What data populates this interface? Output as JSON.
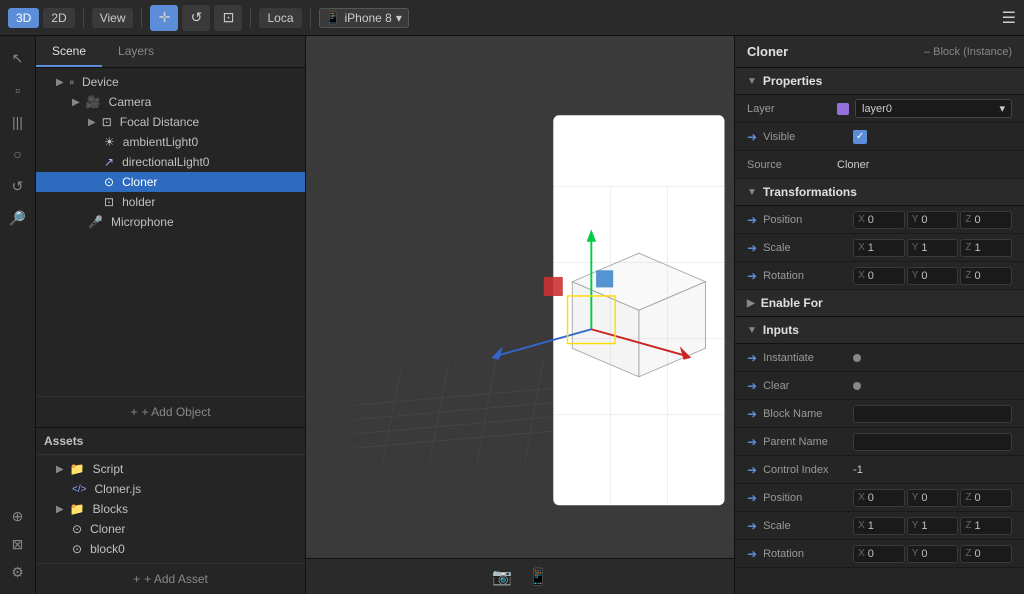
{
  "topbar": {
    "btn_3d": "3D",
    "btn_2d": "2D",
    "btn_view": "View",
    "btn_loc": "Loca",
    "device_name": "iPhone 8",
    "icons": [
      "✛",
      "↺",
      "⊡"
    ]
  },
  "scene_panel": {
    "tab_scene": "Scene",
    "tab_layers": "Layers",
    "tree": [
      {
        "label": "Device",
        "level": 1,
        "icon": "▫",
        "type": "folder",
        "arrow": "▶"
      },
      {
        "label": "Camera",
        "level": 2,
        "icon": "📷",
        "type": "folder",
        "arrow": "▶"
      },
      {
        "label": "Focal Distance",
        "level": 3,
        "icon": "⊡",
        "type": "folder",
        "arrow": "▶"
      },
      {
        "label": "ambientLight0",
        "level": 4,
        "icon": "☀",
        "type": "item"
      },
      {
        "label": "directionalLight0",
        "level": 4,
        "icon": "↗",
        "type": "item"
      },
      {
        "label": "Cloner",
        "level": 4,
        "icon": "⊙",
        "type": "item",
        "selected": true
      },
      {
        "label": "holder",
        "level": 4,
        "icon": "⊡",
        "type": "item"
      },
      {
        "label": "Microphone",
        "level": 3,
        "icon": "🎤",
        "type": "item"
      }
    ],
    "add_object": "+ Add Object"
  },
  "assets_panel": {
    "header": "Assets",
    "tree": [
      {
        "label": "Script",
        "level": 1,
        "icon": "📁",
        "type": "folder",
        "arrow": "▶"
      },
      {
        "label": "Cloner.js",
        "level": 2,
        "icon": "</>",
        "type": "item"
      },
      {
        "label": "Blocks",
        "level": 1,
        "icon": "📁",
        "type": "folder",
        "arrow": "▶"
      },
      {
        "label": "Cloner",
        "level": 2,
        "icon": "⊙",
        "type": "item"
      },
      {
        "label": "block0",
        "level": 2,
        "icon": "⊙",
        "type": "item"
      }
    ],
    "add_asset": "+ Add Asset",
    "add_icon": "+"
  },
  "viewport": {
    "bottom_icons": [
      "📷",
      "📱"
    ]
  },
  "properties": {
    "title": "Cloner",
    "subtitle": "– Block (Instance)",
    "sections": {
      "properties": "Properties",
      "transformations": "Transformations",
      "enable_for": "Enable For",
      "inputs": "Inputs"
    },
    "layer_label": "Layer",
    "layer_value": "layer0",
    "visible_label": "Visible",
    "source_label": "Source",
    "source_value": "Cloner",
    "position_label": "Position",
    "scale_label": "Scale",
    "rotation_label": "Rotation",
    "position1": {
      "x": "0",
      "y": "0",
      "z": "0"
    },
    "scale1": {
      "x": "1",
      "y": "1",
      "z": "1"
    },
    "rotation1": {
      "x": "0",
      "y": "0",
      "z": "0"
    },
    "instantiate_label": "Instantiate",
    "clear_label": "Clear",
    "block_name_label": "Block Name",
    "parent_name_label": "Parent Name",
    "control_index_label": "Control Index",
    "control_index_value": "-1",
    "position2": {
      "x": "0",
      "y": "0",
      "z": "0"
    },
    "scale2": {
      "x": "1",
      "y": "1",
      "z": "1"
    },
    "rotation2": {
      "x": "0",
      "y": "0",
      "z": "0"
    }
  },
  "left_icons": [
    "🔍",
    "⊡",
    "|||",
    "○",
    "↺",
    "🔎",
    "⊕",
    "⊠",
    "⚙"
  ]
}
